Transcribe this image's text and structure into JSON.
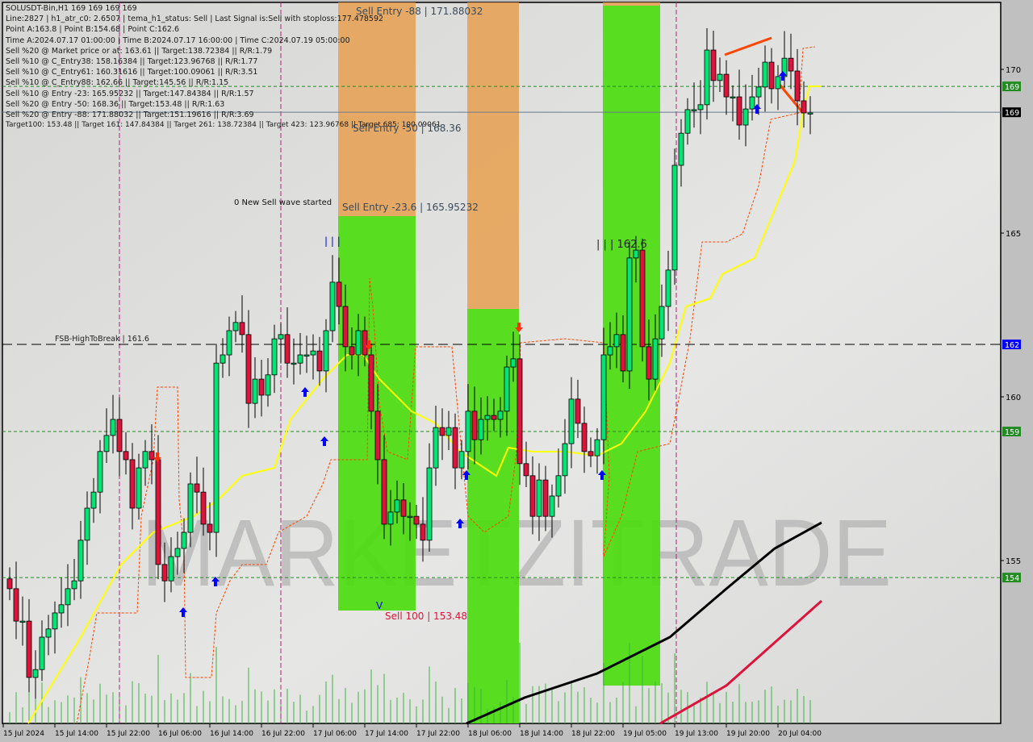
{
  "header": {
    "symbol_line": "SOLUSDT-Bin,H1  169 169 169 169",
    "lines": [
      "Line:2827 | h1_atr_c0: 2.6507 | tema_h1_status: Sell | Last Signal is:Sell with stoploss:177.478592",
      "Point A:163.8 | Point B:154.68 | Point C:162.6",
      "Time A:2024.07.17 01:00:00 | Time B:2024.07.17 16:00:00 | Time C:2024.07.19 05:00:00",
      "Sell %20 @ Market price or at: 163.61 || Target:138.72384 || R/R:1.79",
      "Sell %10 @ C_Entry38: 158.16384 || Target:123.96768 || R/R:1.77",
      "Sell %10 @ C_Entry61: 160.31616 || Target:100.09061 || R/R:3.51",
      "Sell %10 @ C_Entry88: 162.66 || Target:145.56 || R/R:1.15",
      "Sell %10 @ Entry -23: 165.95232 || Target:147.84384 || R/R:1.57",
      "Sell %20 @ Entry -50: 168.36 || Target:153.48 || R/R:1.63",
      "Sell %20 @ Entry -88: 171.88032 || Target:151.19616 || R/R:3.69",
      "Target100: 153.48 || Target 161: 147.84384 || Target 261: 138.72384 || Target 423: 123.96768 || Target 685: 100.09061"
    ]
  },
  "annotations": {
    "sell_entry_88": "Sell Entry -88 | 171.88032",
    "sell_entry_50": "Sell Entry -50 | 168.36",
    "sell_entry_236": "Sell Entry -23.6 | 165.95232",
    "new_wave": "0 New Sell wave started",
    "bars_blue": "| | |",
    "point_c": "| | | 162.6",
    "fsb": "FSB-HighToBreak | 161.6",
    "sell_100": "Sell 100 | 153.48",
    "v_mark": "V",
    "watermark": "MARKETZITRADE"
  },
  "colors": {
    "bull": "#00e676",
    "bear": "#dc143c",
    "zone_orange": "#e8a050",
    "zone_green": "#4ddc10",
    "ma_yellow": "#ffff00",
    "trend_black": "#000000",
    "trend_red": "#dc143c",
    "stop_dashed": "#ff4500",
    "level_green": "#228b22",
    "fsb_blue": "#0000ff"
  },
  "chart_data": {
    "type": "candlestick",
    "symbol": "SOLUSDT-Bin",
    "timeframe": "H1",
    "ylim": [
      149.9,
      174
    ],
    "y_ticks": [
      155,
      160,
      165,
      170
    ],
    "x_tick_labels": [
      "15 Jul 2024",
      "15 Jul 14:00",
      "15 Jul 22:00",
      "16 Jul 06:00",
      "16 Jul 14:00",
      "16 Jul 22:00",
      "17 Jul 06:00",
      "17 Jul 14:00",
      "17 Jul 22:00",
      "18 Jul 06:00",
      "18 Jul 14:00",
      "18 Jul 22:00",
      "19 Jul 05:00",
      "19 Jul 13:00",
      "19 Jul 20:00",
      "20 Jul 04:00"
    ],
    "closes": [
      154.14,
      153.15,
      153.15,
      151.43,
      151.67,
      152.66,
      152.91,
      153.4,
      153.65,
      154.14,
      154.38,
      155.62,
      156.6,
      157.09,
      158.33,
      158.82,
      159.31,
      158.33,
      158.08,
      156.6,
      157.83,
      158.33,
      158.08,
      154.88,
      154.38,
      155.12,
      155.37,
      155.86,
      157.34,
      157.09,
      156.11,
      155.86,
      161.03,
      161.28,
      162.02,
      162.27,
      161.9,
      159.8,
      160.54,
      160.05,
      160.67,
      161.77,
      161.9,
      161.03,
      161.03,
      161.28,
      161.28,
      161.4,
      160.79,
      162.02,
      163.5,
      162.76,
      161.53,
      161.28,
      162.02,
      161.28,
      159.56,
      158.08,
      156.11,
      156.48,
      156.85,
      156.35,
      156.35,
      156.11,
      155.62,
      157.83,
      159.06,
      158.82,
      159.06,
      157.83,
      158.33,
      159.56,
      158.69,
      159.31,
      159.43,
      159.31,
      159.56,
      160.91,
      161.16,
      157.96,
      157.59,
      156.35,
      157.46,
      156.35,
      156.97,
      157.59,
      158.57,
      159.93,
      159.19,
      158.33,
      158.2,
      158.69,
      161.28,
      161.53,
      161.9,
      160.79,
      164.24,
      164.48,
      161.53,
      160.54,
      161.77,
      162.76,
      163.87,
      167.07,
      168.05,
      168.77,
      168.77,
      168.92,
      170.59,
      169.66,
      169.85,
      169.16,
      169.16,
      168.3,
      168.79,
      169.16,
      169.46,
      170.22,
      169.41,
      169.78,
      170.34,
      169.95,
      169.04,
      168.67,
      168.67
    ],
    "levels": [
      {
        "label": "169",
        "price": 169.48,
        "style": "green-dashed"
      },
      {
        "label": "169",
        "price": 168.69,
        "style": "current-price"
      },
      {
        "label": "162",
        "price": 161.6,
        "style": "blue-dashed"
      },
      {
        "label": "159",
        "price": 158.94,
        "style": "green-dashed"
      },
      {
        "label": "154",
        "price": 154.48,
        "style": "green-dashed"
      }
    ]
  }
}
